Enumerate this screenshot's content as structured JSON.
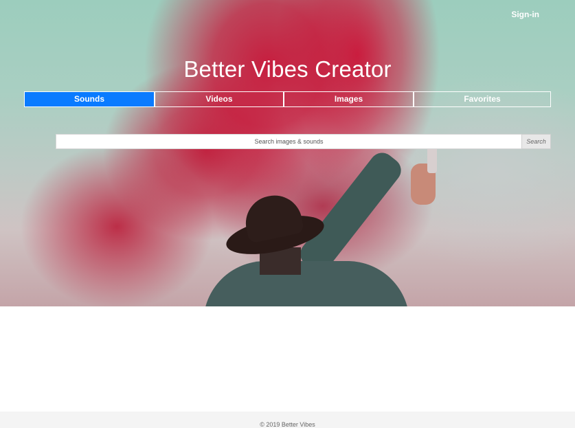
{
  "header": {
    "signin_label": "Sign-in"
  },
  "hero": {
    "title": "Better Vibes Creator"
  },
  "tabs": [
    {
      "label": "Sounds",
      "active": true
    },
    {
      "label": "Videos",
      "active": false
    },
    {
      "label": "Images",
      "active": false
    },
    {
      "label": "Favorites",
      "active": false
    }
  ],
  "search": {
    "placeholder": "Search images & sounds",
    "button_label": "Search"
  },
  "footer": {
    "text": "© 2019 Better Vibes"
  },
  "colors": {
    "accent": "#0a7bff",
    "footer_bg": "#f4f4f4"
  }
}
